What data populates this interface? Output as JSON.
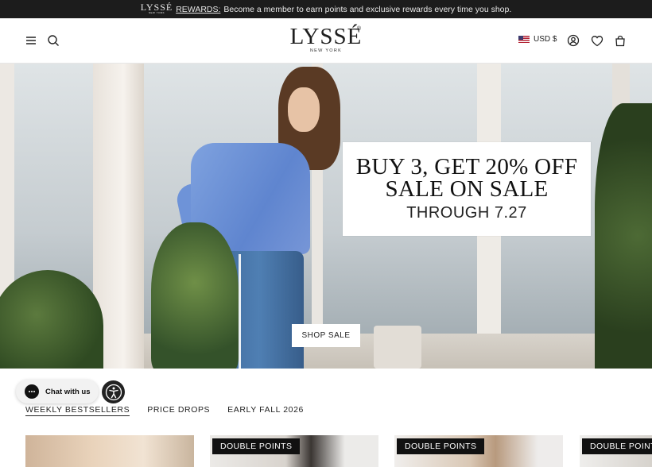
{
  "announcement": {
    "logo": "LYSSÉ",
    "logo_sub": "NEW YORK",
    "rewards_label": "REWARDS:",
    "message": "Become a member to earn points and exclusive rewards every time you shop."
  },
  "header": {
    "logo": "LYSSÉ",
    "logo_reg": "®",
    "logo_sub": "NEW YORK",
    "currency": "USD $"
  },
  "hero": {
    "promo_line1": "BUY 3, GET 20% OFF",
    "promo_line2": "SALE ON SALE",
    "promo_line3": "THROUGH 7.27",
    "button_label": "SHOP SALE"
  },
  "chat": {
    "label": "Chat with us"
  },
  "tabs": [
    {
      "label": "WEEKLY BESTSELLERS",
      "active": true
    },
    {
      "label": "PRICE DROPS",
      "active": false
    },
    {
      "label": "EARLY FALL 2026",
      "active": false
    }
  ],
  "products": [
    {
      "badge": ""
    },
    {
      "badge": "DOUBLE POINTS"
    },
    {
      "badge": "DOUBLE POINTS"
    },
    {
      "badge": "DOUBLE POINTS"
    }
  ],
  "colors": {
    "announcement_bg": "#1c1c1c",
    "badge_bg": "#111111"
  }
}
